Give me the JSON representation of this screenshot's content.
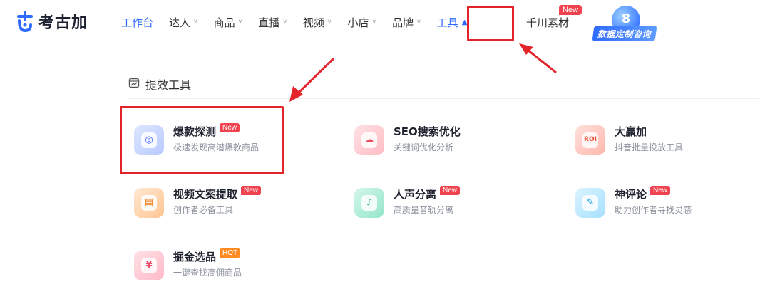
{
  "logo": {
    "text": "考古加",
    "icon": "kaogujia-logo-icon"
  },
  "nav": {
    "items": [
      {
        "label": "工作台",
        "has_dropdown": false
      },
      {
        "label": "达人",
        "has_dropdown": true
      },
      {
        "label": "商品",
        "has_dropdown": true
      },
      {
        "label": "直播",
        "has_dropdown": true
      },
      {
        "label": "视频",
        "has_dropdown": true
      },
      {
        "label": "小店",
        "has_dropdown": true
      },
      {
        "label": "品牌",
        "has_dropdown": true
      },
      {
        "label": "工具",
        "has_dropdown": true
      }
    ],
    "qianchuan": {
      "label": "千川素材",
      "badge": "New"
    },
    "consult": {
      "label": "数据定制咨询",
      "icon_glyph": "8"
    },
    "accent_color": "#2f6bff"
  },
  "panel": {
    "section_title": "提效工具",
    "section_icon": "calendar-chart-icon",
    "tools": [
      {
        "name": "爆款探测",
        "desc": "极速发现高潜爆款商品",
        "tag": "New",
        "icon": "radar-detect-icon"
      },
      {
        "name": "SEO搜索优化",
        "desc": "关键词优化分析",
        "tag": "",
        "icon": "cloud-search-icon"
      },
      {
        "name": "大赢加",
        "desc": "抖音批量投放工具",
        "tag": "",
        "icon": "roi-window-icon"
      },
      {
        "name": "视频文案提取",
        "desc": "创作者必备工具",
        "tag": "New",
        "icon": "video-text-icon"
      },
      {
        "name": "人声分离",
        "desc": "高质量音轨分离",
        "tag": "New",
        "icon": "voice-separate-icon"
      },
      {
        "name": "神评论",
        "desc": "助力创作者寻找灵感",
        "tag": "New",
        "icon": "comment-icon"
      },
      {
        "name": "掘金选品",
        "desc": "一键查找高佣商品",
        "tag": "HOT",
        "icon": "gold-bag-icon"
      }
    ]
  },
  "annotation_color": "#e4242b"
}
